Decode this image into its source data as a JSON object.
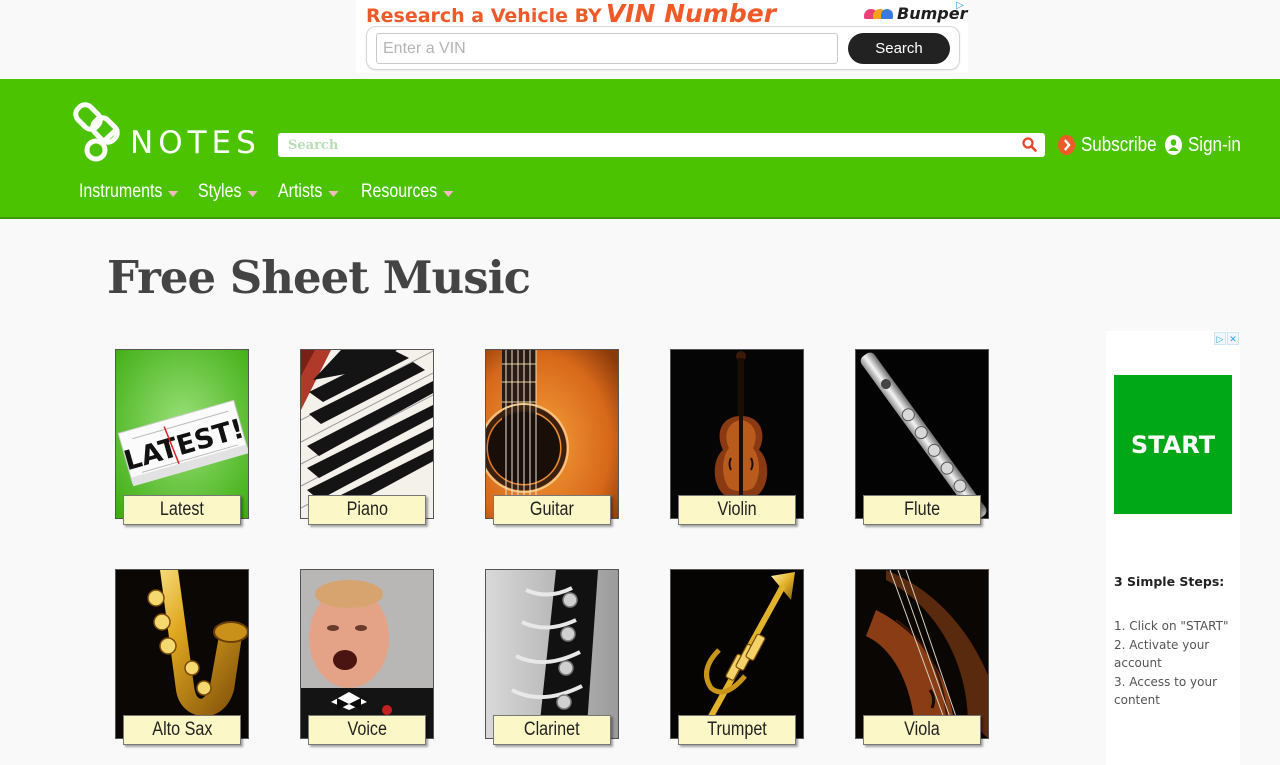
{
  "top_ad": {
    "headline": "Research a Vehicle BY",
    "headline_em": "VIN Number",
    "brand": "Bumper",
    "choice_icon": "ad-choices-icon",
    "vin_placeholder": "Enter a VIN",
    "search_label": "Search"
  },
  "header": {
    "logo_text": "NOTES",
    "search_placeholder": "Search",
    "subscribe_label": "Subscribe",
    "signin_label": "Sign-in",
    "nav": [
      {
        "label": "Instruments"
      },
      {
        "label": "Styles"
      },
      {
        "label": "Artists"
      },
      {
        "label": "Resources"
      }
    ],
    "colors": {
      "bar": "#4cc300",
      "caret": "#f7b8c4",
      "subscribe_icon": "#f05a28"
    }
  },
  "main": {
    "title": "Free Sheet Music",
    "tiles": [
      {
        "label": "Latest",
        "icon": "latest-newspaper-image"
      },
      {
        "label": "Piano",
        "icon": "piano-keys-image"
      },
      {
        "label": "Guitar",
        "icon": "guitar-image"
      },
      {
        "label": "Violin",
        "icon": "violin-image"
      },
      {
        "label": "Flute",
        "icon": "flute-image"
      },
      {
        "label": "Alto Sax",
        "icon": "saxophone-image"
      },
      {
        "label": "Voice",
        "icon": "singer-image"
      },
      {
        "label": "Clarinet",
        "icon": "clarinet-image"
      },
      {
        "label": "Trumpet",
        "icon": "trumpet-image"
      },
      {
        "label": "Viola",
        "icon": "viola-image"
      }
    ],
    "latest_stamp": "LATEST!"
  },
  "side_ad": {
    "start_label": "START",
    "steps_title": "3 Simple Steps:",
    "steps": [
      "1. Click on \"START\"",
      "2. Activate your account",
      "3. Access to your content"
    ],
    "choice_icons": [
      "ad-choices-icon",
      "close-icon"
    ]
  }
}
